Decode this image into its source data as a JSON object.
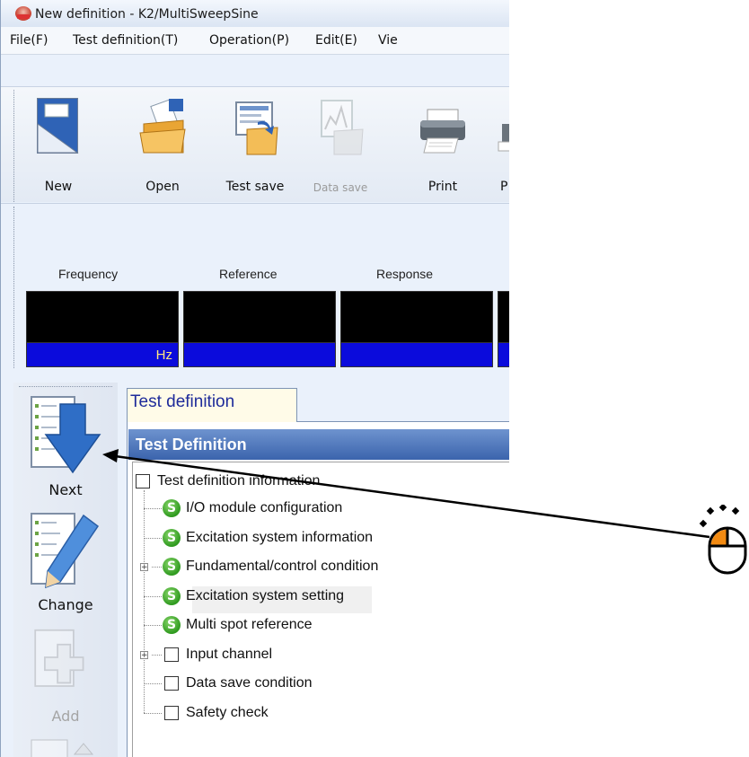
{
  "window": {
    "title": "New definition - K2/MultiSweepSine"
  },
  "menu": [
    "File(F)",
    "Test definition(T)",
    "Operation(P)",
    "Edit(E)",
    "Vie"
  ],
  "toolbar": {
    "buttons": [
      {
        "label": "New",
        "icon": "new-document-icon",
        "enabled": true
      },
      {
        "label": "Open",
        "icon": "open-folder-icon",
        "enabled": true
      },
      {
        "label": "Test save",
        "icon": "test-save-icon",
        "enabled": true
      },
      {
        "label": "Data save",
        "icon": "data-save-icon",
        "enabled": false
      },
      {
        "label": "Print",
        "icon": "printer-icon",
        "enabled": true
      },
      {
        "label": "P",
        "icon": "print-preview-icon",
        "enabled": true
      }
    ]
  },
  "monitor": {
    "channels": [
      {
        "label": "Frequency",
        "unit": "Hz"
      },
      {
        "label": "Reference",
        "unit": ""
      },
      {
        "label": "Response",
        "unit": ""
      }
    ]
  },
  "sidebar": {
    "buttons": [
      {
        "label": "Next",
        "icon": "next-arrow-icon",
        "enabled": true
      },
      {
        "label": "Change",
        "icon": "change-pencil-icon",
        "enabled": true
      },
      {
        "label": "Add",
        "icon": "add-plus-icon",
        "enabled": false
      }
    ]
  },
  "tab": {
    "label": "Test definition"
  },
  "panel": {
    "title": "Test Definition"
  },
  "tree": {
    "root": "Test definition information",
    "items": [
      {
        "label": "I/O module configuration",
        "state": "set",
        "expandable": false
      },
      {
        "label": "Excitation system information",
        "state": "set",
        "expandable": false
      },
      {
        "label": "Fundamental/control condition",
        "state": "set",
        "expandable": true
      },
      {
        "label": "Excitation system setting",
        "state": "set",
        "expandable": false
      },
      {
        "label": "Multi spot reference",
        "state": "set",
        "expandable": false
      },
      {
        "label": "Input channel",
        "state": "unset",
        "expandable": true
      },
      {
        "label": "Data save condition",
        "state": "unset",
        "expandable": false
      },
      {
        "label": "Safety check",
        "state": "unset",
        "expandable": false
      }
    ]
  },
  "annotation": {
    "icon": "mouse-click-icon",
    "points_to": "Next"
  },
  "colors": {
    "monitor_unit_bg": "#0b0bdc",
    "monitor_unit_text": "#ffe680",
    "panel_header": "#4a73b8",
    "status_set": "#2f9a1f"
  }
}
